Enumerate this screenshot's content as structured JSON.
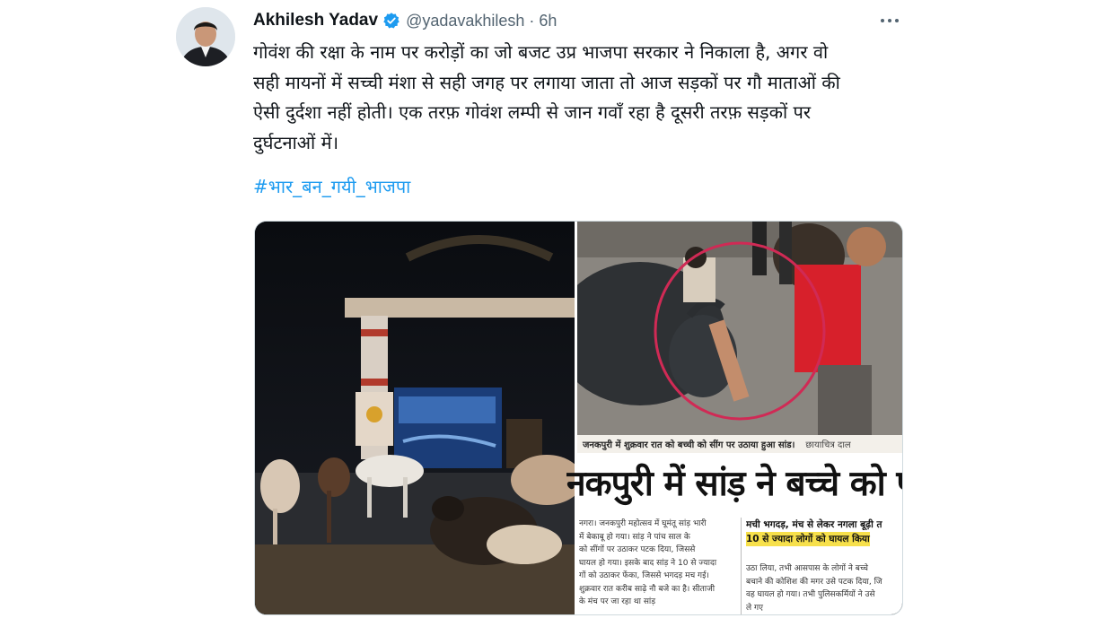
{
  "tweet": {
    "author_name": "Akhilesh Yadav",
    "handle": "@yadavakhilesh",
    "separator": "·",
    "time": "6h",
    "text_lines": [
      "गोवंश की रक्षा के नाम पर करोड़ों का जो बजट उप्र भाजपा सरकार ने निकाला है, अगर वो",
      "सही मायनों में सच्ची मंशा से सही जगह पर लगाया जाता तो आज सड़कों पर गौ माताओं की",
      "ऐसी दुर्दशा नहीं होती। एक तरफ़ गोवंश लम्पी से जान गवाँ रहा है दूसरी तरफ़  सड़कों पर",
      "दुर्घटनाओं में।"
    ],
    "hashtag": "#भार_बन_गयी_भाजपा",
    "icons": {
      "verified": "verified-badge-icon",
      "more": "more-options-icon"
    },
    "colors": {
      "link": "#1d9bf0",
      "secondary_text": "#536471",
      "primary_text": "#0f1419",
      "verified": "#1d9bf0"
    }
  },
  "media": {
    "newspaper": {
      "photo_caption": "जनकपुरी में शुक्रवार रात को बच्ची को सींग पर उठाया हुआ सांड।",
      "photo_credit": "छायाचित्र दाल",
      "headline": "नकपुरी में सांड़ ने बच्चे को पटक",
      "subhead_line1": "मची भगदड़, मंच से लेकर नगला बूढ़ी त",
      "subhead_line2": "10 से ज्यादा लोगों को घायल किया",
      "left_column": [
        "नगरा। जनकपुरी महोत्सव में घूमंतू सांड़ भारी",
        "में बेकाबू हो गया। सांड़ ने पांच साल के",
        "को सींगों पर उठाकर पटक दिया, जिससे",
        "घायल हो गया। इसके बाद सांड़ ने 10 से ज्यादा",
        "गों को उठाकर फेंका, जिससे भगदड़ मच गई।",
        "शुक्रवार रात करीब साढ़े नौ बजे का है। सीताजी",
        "के मंच पर जा रहा था सांड़"
      ],
      "right_column": [
        "उठा लिया, तभी आसपास के लोगों ने बच्चे",
        "बचाने की कोशिश की मगर उसे पटक दिया, जि",
        "वह घायल हो गया। तभी पुलिसकर्मियों ने उसे",
        "ले गए"
      ]
    }
  }
}
